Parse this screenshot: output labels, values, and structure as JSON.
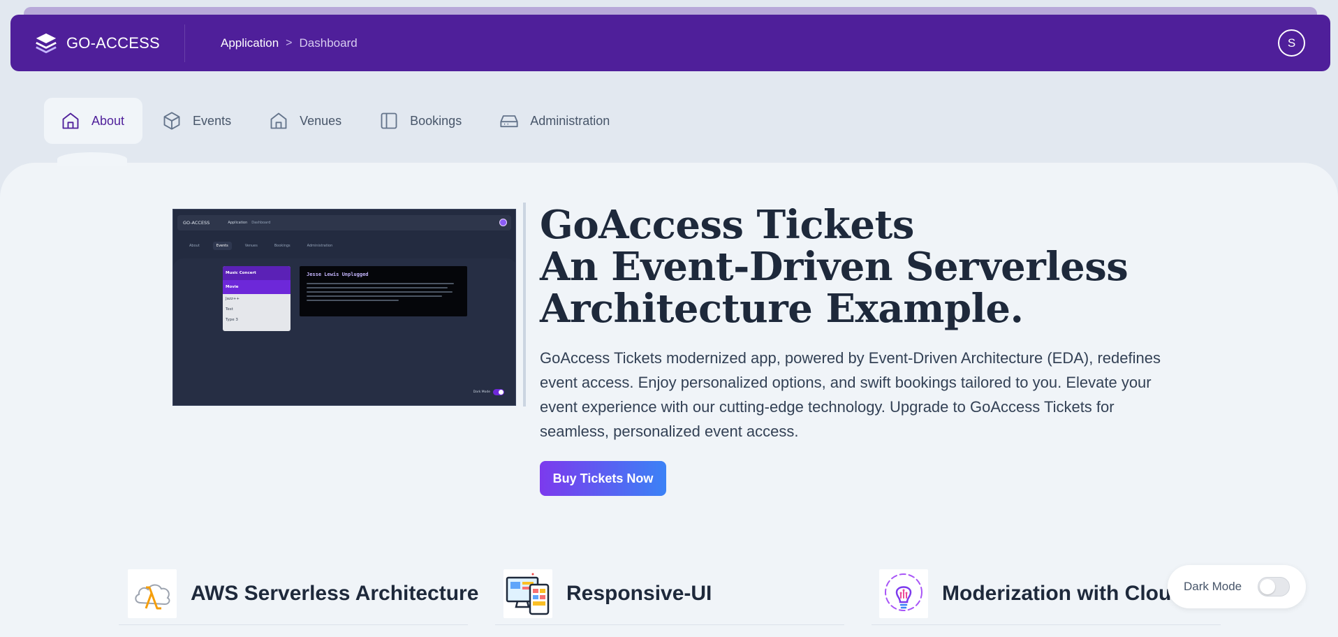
{
  "header": {
    "logo_text": "GO-ACCESS",
    "breadcrumb": {
      "parent": "Application",
      "separator": ">",
      "current": "Dashboard"
    },
    "avatar_initial": "S"
  },
  "nav": {
    "tabs": [
      {
        "label": "About",
        "icon": "home-icon",
        "active": true
      },
      {
        "label": "Events",
        "icon": "cube-icon",
        "active": false
      },
      {
        "label": "Venues",
        "icon": "venue-icon",
        "active": false
      },
      {
        "label": "Bookings",
        "icon": "sidebar-icon",
        "active": false
      },
      {
        "label": "Administration",
        "icon": "drive-icon",
        "active": false
      }
    ]
  },
  "preview": {
    "logo_text": "GO-ACCESS",
    "crumb_parent": "Application",
    "crumb_current": "Dashboard",
    "tabs": [
      "About",
      "Events",
      "Venues",
      "Bookings",
      "Administration"
    ],
    "list": [
      "Music Concert",
      "Movie",
      "Jazz++",
      "Test",
      "Type 3"
    ],
    "card_title": "Jesse Lewis Unplugged",
    "dark_mode_label": "Dark Mode"
  },
  "hero": {
    "title_line1": "GoAccess Tickets",
    "title_line2": "An Event-Driven Serverless",
    "title_line3": "Architecture Example.",
    "description": "GoAccess Tickets modernized app, powered by Event-Driven Architecture (EDA), redefines event access. Enjoy personalized options, and swift bookings tailored to you. Elevate your event experience with our cutting-edge technology. Upgrade to GoAccess Tickets for seamless, personalized event access.",
    "cta_label": "Buy Tickets Now"
  },
  "features": [
    {
      "title": "AWS Serverless Architecture",
      "icon": "aws-lambda-cloud-icon"
    },
    {
      "title": "Responsive-UI",
      "icon": "responsive-devices-icon"
    },
    {
      "title": "Moderization with Cloud",
      "icon": "lightbulb-gear-icon"
    }
  ],
  "dark_mode": {
    "label": "Dark Mode",
    "enabled": false
  },
  "colors": {
    "header_bg": "#4f1f9a",
    "active_tab_text": "#4f1f9a",
    "cta_gradient_start": "#7c3aed",
    "cta_gradient_end": "#3b82f6",
    "page_bg": "#f0f4f8"
  }
}
